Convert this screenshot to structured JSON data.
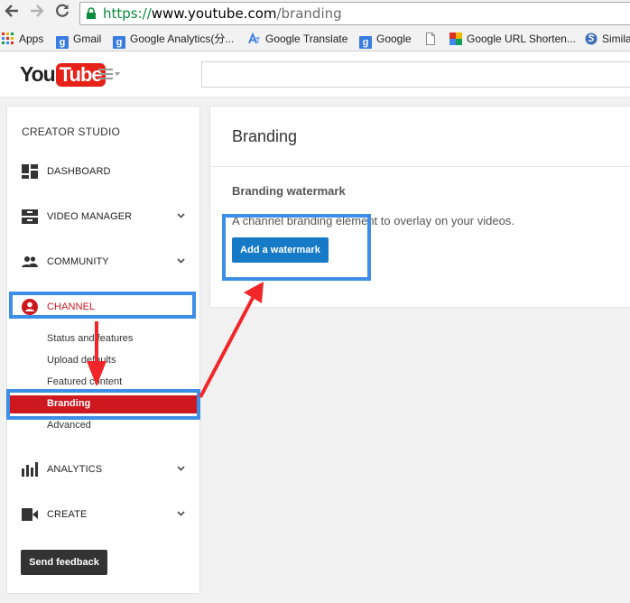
{
  "browser": {
    "url_scheme": "https://",
    "url_host": "www.youtube.com",
    "url_path": "/branding",
    "bookmarks": [
      {
        "label": "Apps",
        "icon": "apps-grid-icon"
      },
      {
        "label": "Gmail",
        "icon": "google-icon"
      },
      {
        "label": "Google Analytics(分...",
        "icon": "google-icon"
      },
      {
        "label": "Google Translate",
        "icon": "translate-icon"
      },
      {
        "label": "Google",
        "icon": "google-icon"
      },
      {
        "label": "",
        "icon": "page-icon"
      },
      {
        "label": "Google URL Shorten...",
        "icon": "google-color-icon"
      },
      {
        "label": "Simila",
        "icon": "similar-icon"
      }
    ]
  },
  "header": {
    "logo_you": "You",
    "logo_tube": "Tube"
  },
  "sidebar": {
    "title": "CREATOR STUDIO",
    "items": [
      {
        "label": "DASHBOARD",
        "icon": "dashboard-icon"
      },
      {
        "label": "VIDEO MANAGER",
        "icon": "video-manager-icon"
      },
      {
        "label": "COMMUNITY",
        "icon": "community-icon"
      },
      {
        "label": "CHANNEL",
        "icon": "channel-icon"
      },
      {
        "label": "ANALYTICS",
        "icon": "analytics-icon"
      },
      {
        "label": "CREATE",
        "icon": "create-icon"
      }
    ],
    "channel_sub": [
      "Status and features",
      "Upload defaults",
      "Featured content",
      "Branding",
      "Advanced"
    ],
    "feedback_label": "Send feedback"
  },
  "main": {
    "page_title": "Branding",
    "section_title": "Branding watermark",
    "section_desc": "A channel branding element to overlay on your videos.",
    "watermark_button": "Add a watermark"
  },
  "colors": {
    "accent_red": "#cc181e",
    "button_blue": "#167ac6",
    "annotation_blue": "#3d8ee8",
    "annotation_arrow": "#f0262a"
  }
}
